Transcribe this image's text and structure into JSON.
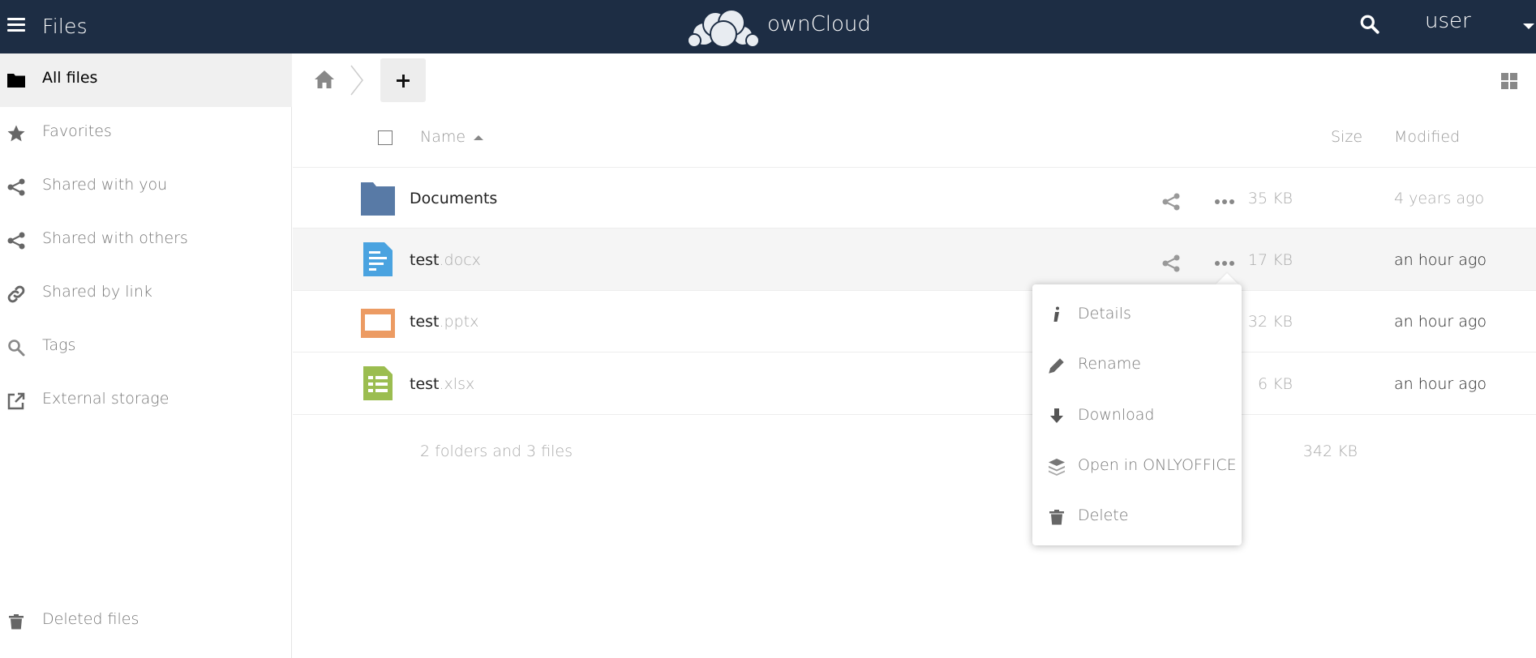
{
  "header": {
    "app_title": "Files",
    "brand": "ownCloud",
    "user": "user"
  },
  "sidebar": {
    "items": [
      {
        "label": "All files",
        "icon": "folder-icon",
        "active": true
      },
      {
        "label": "Favorites",
        "icon": "star-icon"
      },
      {
        "label": "Shared with you",
        "icon": "share-icon"
      },
      {
        "label": "Shared with others",
        "icon": "share-icon"
      },
      {
        "label": "Shared by link",
        "icon": "link-icon"
      },
      {
        "label": "Tags",
        "icon": "tag-search-icon"
      },
      {
        "label": "External storage",
        "icon": "external-link-icon"
      }
    ],
    "deleted": {
      "label": "Deleted files",
      "icon": "trash-icon"
    }
  },
  "table": {
    "columns": {
      "name": "Name",
      "size": "Size",
      "modified": "Modified"
    },
    "rows": [
      {
        "base": "Documents",
        "ext": "",
        "size": "35 KB",
        "modified": "4 years ago",
        "type": "folder"
      },
      {
        "base": "test",
        "ext": ".docx",
        "size": "17 KB",
        "modified": "an hour ago",
        "type": "docx"
      },
      {
        "base": "test",
        "ext": ".pptx",
        "size": "32 KB",
        "modified": "an hour ago",
        "type": "pptx"
      },
      {
        "base": "test",
        "ext": ".xlsx",
        "size": "6 KB",
        "modified": "an hour ago",
        "type": "xlsx"
      }
    ],
    "summary": {
      "text": "2 folders and 3 files",
      "size": "342 KB"
    }
  },
  "menu": {
    "items": [
      {
        "label": "Details",
        "icon": "info-icon"
      },
      {
        "label": "Rename",
        "icon": "pencil-icon"
      },
      {
        "label": "Download",
        "icon": "download-icon"
      },
      {
        "label": "Open in ONLYOFFICE",
        "icon": "layers-icon"
      },
      {
        "label": "Delete",
        "icon": "trash-icon"
      }
    ]
  },
  "colors": {
    "header_bg": "#1d2d44",
    "folder": "#587aa6",
    "docx": "#4aa3e0",
    "pptx": "#ec9b63",
    "xlsx": "#9bbd50"
  }
}
